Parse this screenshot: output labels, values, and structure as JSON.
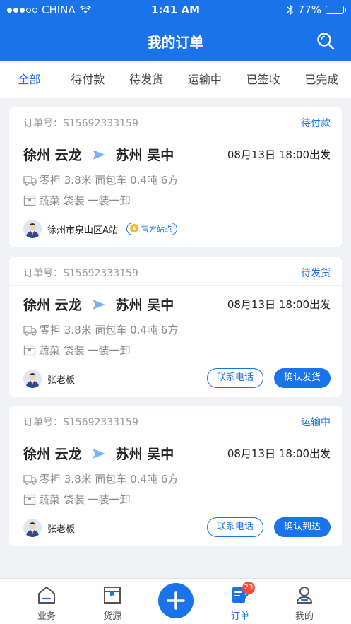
{
  "status_bar": {
    "carrier": "CHINA",
    "time": "1:41 AM",
    "battery": "77%"
  },
  "header": {
    "title": "我的订单"
  },
  "tabs": [
    {
      "label": "全部",
      "active": true
    },
    {
      "label": "待付款"
    },
    {
      "label": "待发货"
    },
    {
      "label": "运输中"
    },
    {
      "label": "已签收"
    },
    {
      "label": "已完成"
    }
  ],
  "orders": [
    {
      "order_no": "订单号：S15692333159",
      "status": "待付款",
      "from": "徐州 云龙",
      "to": "苏州 吴中",
      "depart": "08月13日 18:00出发",
      "vehicle": "零担 3.8米 面包车 0.4吨 6方",
      "cargo": "蔬菜 袋装 一装一卸",
      "user": "徐州市泉山区A站",
      "badge": "官方站点"
    },
    {
      "order_no": "订单号：S15692333159",
      "status": "待发货",
      "from": "徐州 云龙",
      "to": "苏州 吴中",
      "depart": "08月13日 18:00出发",
      "vehicle": "零担 3.8米 面包车 0.4吨 6方",
      "cargo": "蔬菜 袋装 一装一卸",
      "user": "张老板",
      "btn_contact": "联系电话",
      "btn_action": "确认发货"
    },
    {
      "order_no": "订单号：S15692333159",
      "status": "运输中",
      "from": "徐州 云龙",
      "to": "苏州 吴中",
      "depart": "08月13日 18:00出发",
      "vehicle": "零担 3.8米 面包车 0.4吨 6方",
      "cargo": "蔬菜 袋装 一装一卸",
      "user": "张老板",
      "btn_contact": "联系电话",
      "btn_action": "确认到达"
    }
  ],
  "bottom_nav": {
    "items": [
      {
        "label": "业务",
        "icon": "home-icon"
      },
      {
        "label": "货源",
        "icon": "box-icon"
      },
      {
        "label": "订单",
        "icon": "order-icon",
        "active": true,
        "badge": "23"
      },
      {
        "label": "我的",
        "icon": "profile-icon"
      }
    ]
  },
  "colors": {
    "primary": "#1a73e8",
    "background": "#f1f2f5",
    "badge_red": "#f44b3b"
  }
}
